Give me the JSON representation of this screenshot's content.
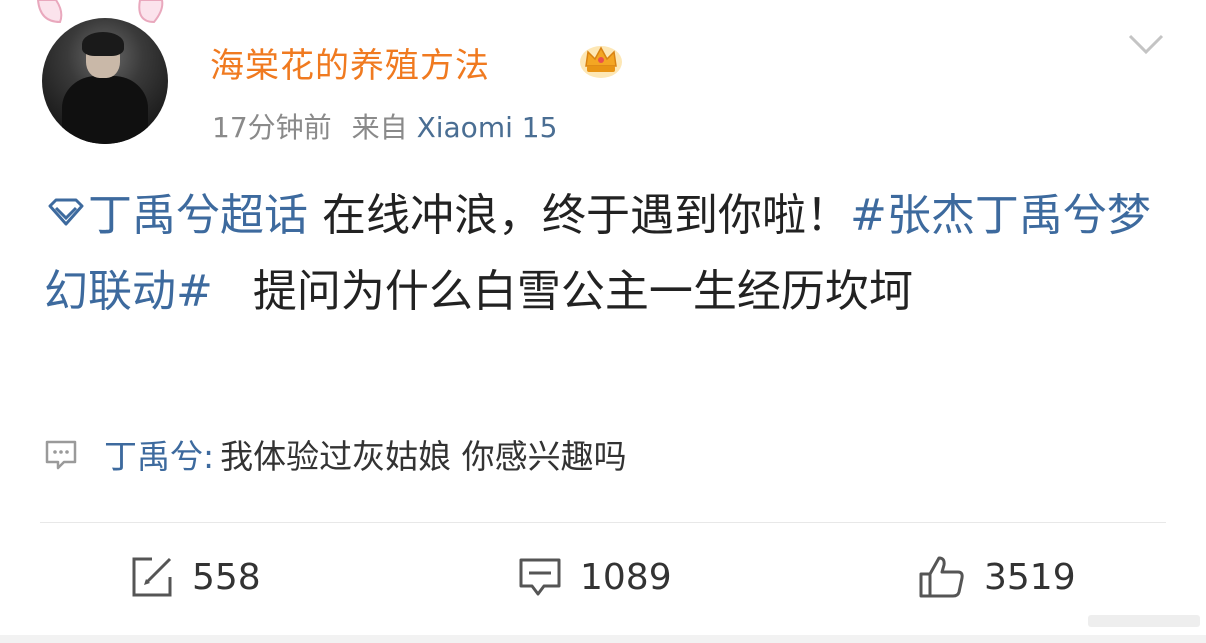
{
  "post": {
    "username": "海棠花的养殖方法",
    "time": "17分钟前",
    "source_prefix": "来自",
    "device": "Xiaomi 15",
    "content": {
      "supertopic": "丁禹兮超话",
      "text1": "在线冲浪，终于遇到你啦！",
      "hashtag": "#张杰丁禹兮梦幻联动#",
      "text2": "提问为什么白雪公主一生经历坎坷"
    },
    "comment": {
      "author": "丁禹兮:",
      "text": "我体验过灰姑娘 你感兴趣吗"
    },
    "actions": {
      "reposts": "558",
      "comments": "1089",
      "likes": "3519"
    }
  },
  "colors": {
    "username": "#f07a20",
    "link": "#3d6a9e",
    "meta": "#8a8a8a"
  },
  "icons": [
    "bunny-ears",
    "crown-badge",
    "chevron-down-icon",
    "super-topic-diamond-icon",
    "comment-bubble-icon",
    "repost-icon",
    "like-icon"
  ]
}
